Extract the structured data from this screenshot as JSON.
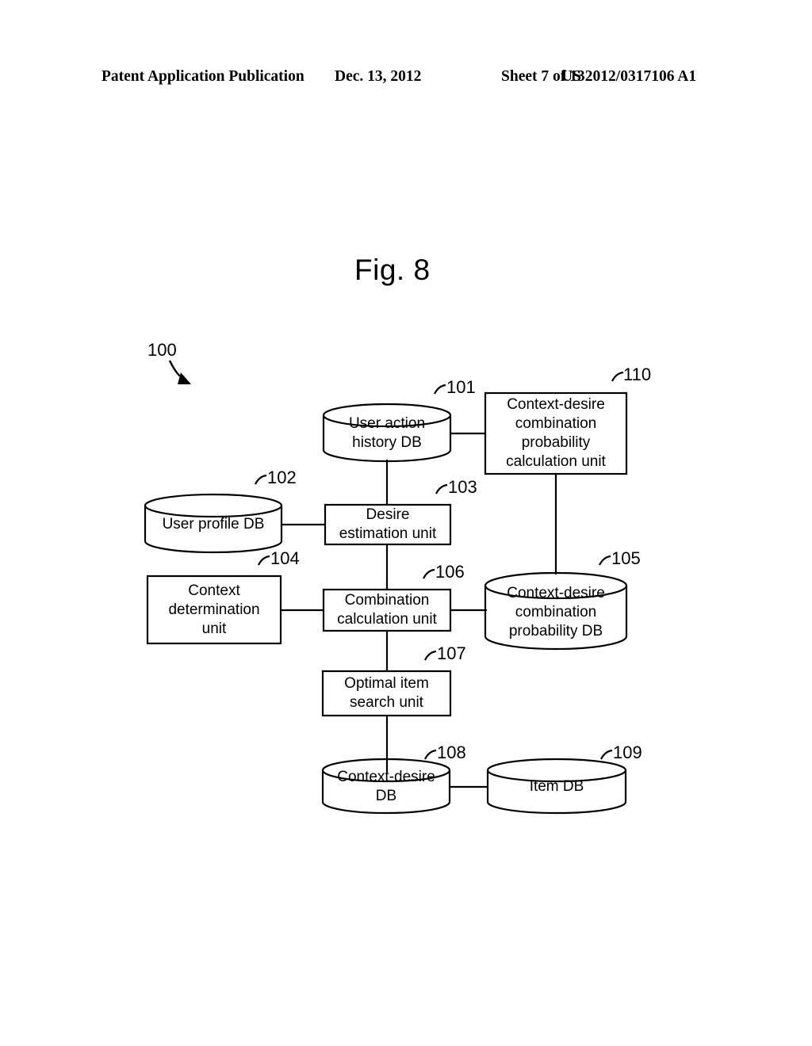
{
  "header": {
    "publication": "Patent Application Publication",
    "date": "Dec. 13, 2012",
    "sheet": "Sheet 7 of 13",
    "patent_number": "US 2012/0317106 A1"
  },
  "figure": {
    "title": "Fig. 8",
    "system_ref": "100"
  },
  "nodes": [
    {
      "ref": "101",
      "label": "User action\nhistory DB",
      "shape": "cylinder"
    },
    {
      "ref": "110",
      "label": "Context-desire\ncombination\nprobability\ncalculation unit",
      "shape": "rectangle"
    },
    {
      "ref": "102",
      "label": "User profile DB",
      "shape": "cylinder"
    },
    {
      "ref": "103",
      "label": "Desire\nestimation unit",
      "shape": "rectangle"
    },
    {
      "ref": "104",
      "label": "Context\ndetermination\nunit",
      "shape": "rectangle"
    },
    {
      "ref": "106",
      "label": "Combination\ncalculation unit",
      "shape": "rectangle"
    },
    {
      "ref": "105",
      "label": "Context-desire\ncombination\nprobability DB",
      "shape": "cylinder"
    },
    {
      "ref": "107",
      "label": "Optimal item\nsearch unit",
      "shape": "rectangle"
    },
    {
      "ref": "108",
      "label": "Context-desire\nDB",
      "shape": "cylinder"
    },
    {
      "ref": "109",
      "label": "Item DB",
      "shape": "cylinder"
    }
  ],
  "connections": [
    {
      "from": "101",
      "to": "110",
      "orientation": "horizontal"
    },
    {
      "from": "101",
      "to": "103",
      "orientation": "vertical"
    },
    {
      "from": "102",
      "to": "103",
      "orientation": "horizontal"
    },
    {
      "from": "110",
      "to": "105",
      "orientation": "vertical"
    },
    {
      "from": "103",
      "to": "106",
      "orientation": "vertical"
    },
    {
      "from": "104",
      "to": "106",
      "orientation": "horizontal"
    },
    {
      "from": "106",
      "to": "105",
      "orientation": "horizontal"
    },
    {
      "from": "106",
      "to": "107",
      "orientation": "vertical"
    },
    {
      "from": "107",
      "to": "108",
      "orientation": "vertical"
    },
    {
      "from": "108",
      "to": "109",
      "orientation": "horizontal"
    }
  ],
  "colors": {
    "ink": "#000000",
    "paper": "#ffffff"
  }
}
